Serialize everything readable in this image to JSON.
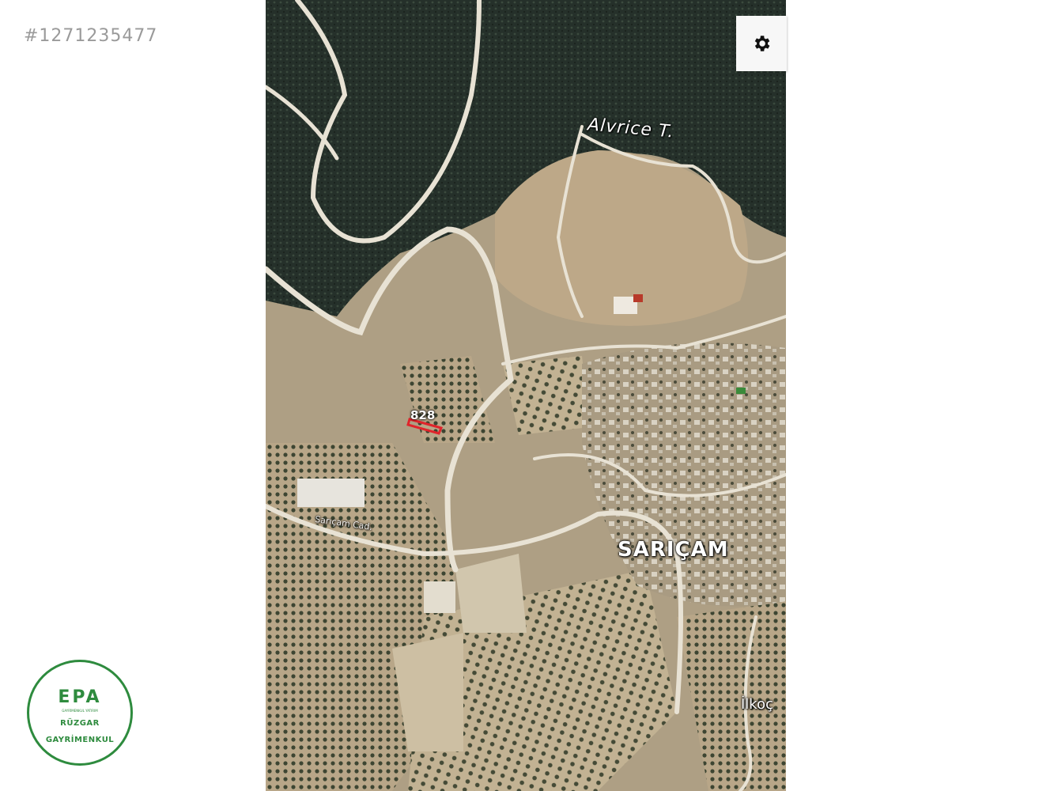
{
  "listing": {
    "id_text": "#1271235477"
  },
  "map": {
    "controls": {
      "settings_icon": "gear-icon"
    },
    "labels": {
      "peak": "Alvrice T.",
      "village": "SARIÇAM",
      "road": "Sarıçam Cad.",
      "partial_place": "İlkoç"
    },
    "parcel": {
      "label": "828",
      "highlight_color": "#e0242b"
    },
    "colors": {
      "forest": "#27352c",
      "field": "#b7a585",
      "road": "#e8e2d4"
    }
  },
  "logo": {
    "brand": "EPA",
    "tagline": "GAYRİMENKUL YATIRIM",
    "line1": "RÜZGAR",
    "line2": "GAYRİMENKUL",
    "color": "#2e8b3e"
  }
}
